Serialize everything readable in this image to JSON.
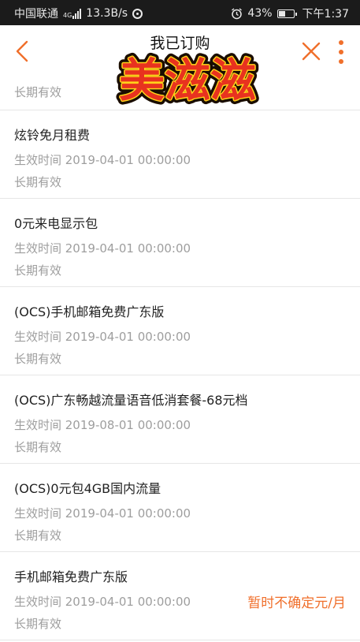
{
  "status_bar": {
    "carrier": "中国联通",
    "network_type": "4G",
    "speed": "13.3B/s",
    "battery_percent": "43%",
    "time": "下午1:37"
  },
  "app_bar": {
    "title": "我已订购",
    "logo_text": "美滋滋",
    "accent_color": "#f06f2b"
  },
  "partial_item": {
    "validity": "长期有效"
  },
  "items": [
    {
      "name": "炫铃免月租费",
      "date": "生效时间 2019-04-01 00:00:00",
      "validity": "长期有效",
      "price": ""
    },
    {
      "name": "0元来电显示包",
      "date": "生效时间 2019-04-01 00:00:00",
      "validity": "长期有效",
      "price": ""
    },
    {
      "name": "(OCS)手机邮箱免费广东版",
      "date": "生效时间 2019-04-01 00:00:00",
      "validity": "长期有效",
      "price": ""
    },
    {
      "name": "(OCS)广东畅越流量语音低消套餐-68元档",
      "date": "生效时间 2019-08-01 00:00:00",
      "validity": "长期有效",
      "price": ""
    },
    {
      "name": "(OCS)0元包4GB国内流量",
      "date": "生效时间 2019-04-01 00:00:00",
      "validity": "长期有效",
      "price": ""
    },
    {
      "name": "手机邮箱免费广东版",
      "date": "生效时间 2019-04-01 00:00:00",
      "validity": "长期有效",
      "price": "暂时不确定元/月"
    }
  ]
}
